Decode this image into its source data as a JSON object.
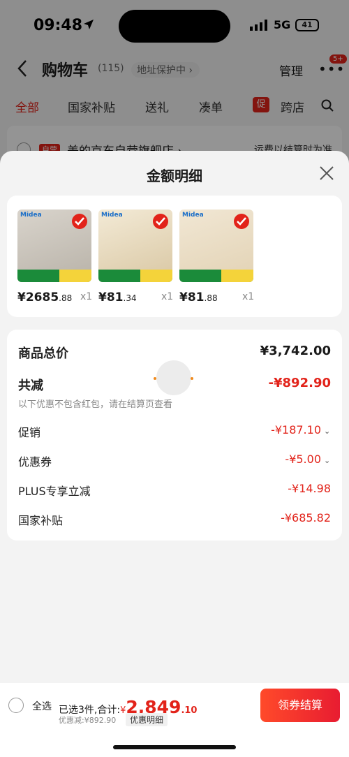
{
  "status": {
    "time": "09:48",
    "network": "5G",
    "battery": "41"
  },
  "header": {
    "title": "购物车",
    "count": "(115)",
    "address_protect": "地址保护中 ›",
    "manage": "管理",
    "badge": "5+"
  },
  "tabs": [
    "全部",
    "国家补贴",
    "送礼",
    "凑单",
    "跨店"
  ],
  "promo_tag": "促",
  "store": {
    "tag": "自营",
    "name": "美的京东自营旗舰店 ›",
    "hint": "运费以结算时为准"
  },
  "sheet": {
    "title": "金额明细",
    "products": [
      {
        "brand": "Midea",
        "price_int": "¥2685",
        "price_dec": ".88",
        "qty": "x1",
        "colors": [
          "#d9d4cc",
          "#b8b2a8"
        ]
      },
      {
        "brand": "Midea",
        "price_int": "¥81",
        "price_dec": ".34",
        "qty": "x1",
        "colors": [
          "#f3ead6",
          "#d9c7a3"
        ]
      },
      {
        "brand": "Midea",
        "price_int": "¥81",
        "price_dec": ".88",
        "qty": "x1",
        "colors": [
          "#f1e7d4",
          "#e2d2b4"
        ]
      }
    ],
    "details": {
      "total_label": "商品总价",
      "total_value": "¥3,742.00",
      "reduce_label": "共减",
      "reduce_value": "-¥892.90",
      "note": "以下优惠不包含红包，请在结算页查看",
      "items": [
        {
          "label": "促销",
          "value": "-¥187.10",
          "expandable": true
        },
        {
          "label": "优惠券",
          "value": "-¥5.00",
          "expandable": true
        },
        {
          "label": "PLUS专享立减",
          "value": "-¥14.98",
          "expandable": false
        },
        {
          "label": "国家补贴",
          "value": "-¥685.82",
          "expandable": false
        }
      ]
    }
  },
  "bottom": {
    "select_all": "全选",
    "selected": "已选3件,合计:",
    "yen": "¥",
    "amount_int": "2,849",
    "amount_dec": ".10",
    "discount": "优惠减:¥892.90",
    "detail_link": "优惠明细",
    "checkout": "领券结算"
  },
  "accent": "#e2231a"
}
